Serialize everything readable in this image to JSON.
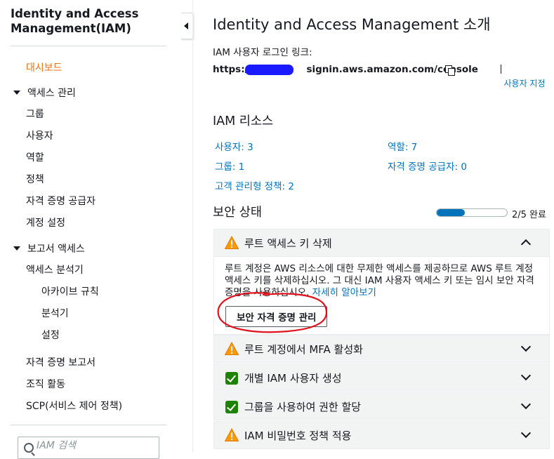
{
  "sidebar": {
    "title": "Identity and Access Management(IAM)",
    "dashboard": "대시보드",
    "access_group": "액세스 관리",
    "access_items": [
      "그룹",
      "사용자",
      "역할",
      "정책",
      "자격 증명 공급자",
      "계정 설정"
    ],
    "report_group": "보고서 액세스",
    "report_items": [
      "액세스 분석기"
    ],
    "analyzer_sub": [
      "아카이브 규칙",
      "분석기",
      "설정"
    ],
    "more_items": [
      "자격 증명 보고서",
      "조직 활동",
      "SCP(서비스 제어 정책)"
    ],
    "search_placeholder": "IAM 검색"
  },
  "main": {
    "title": "Identity and Access Management 소개",
    "signin_label": "IAM 사용자 로그인 링크:",
    "signin_url_prefix": "https://",
    "signin_url_suffix": "signin.aws.amazon.com/console",
    "customize_link": "사용자 지정",
    "resources_title": "IAM 리소스",
    "resources": {
      "users": "사용자: 3",
      "roles": "역할: 7",
      "groups": "그룹: 1",
      "idp": "자격 증명 공급자: 0",
      "policies": "고객 관리형 정책: 2"
    },
    "security_title": "보안 상태",
    "security_progress": 0.4,
    "security_progress_text": "2/5 완료",
    "accordion": [
      {
        "title": "루트 액세스 키 삭제",
        "status": "warning",
        "expanded": true,
        "body": "루트 계정은 AWS 리소스에 대한 무제한 액세스를 제공하므로 AWS 루트 계정 액세스 키를 삭제하십시오. 그 대신 IAM 사용자 액세스 키 또는 임시 보안 자격 증명을 사용하십시오.",
        "learn_more": "자세히 알아보기",
        "button": "보안 자격 증명 관리"
      },
      {
        "title": "루트 계정에서 MFA 활성화",
        "status": "warning",
        "expanded": false
      },
      {
        "title": "개별 IAM 사용자 생성",
        "status": "complete",
        "expanded": false
      },
      {
        "title": "그룹을 사용하여 권한 할당",
        "status": "complete",
        "expanded": false
      },
      {
        "title": "IAM 비밀번호 정책 적용",
        "status": "warning",
        "expanded": false
      }
    ]
  },
  "colors": {
    "accent_orange": "#ec7211",
    "link_blue": "#0073bb",
    "warning_orange": "#ff9900",
    "success_green": "#1d8102",
    "annotation_red": "#e0141e",
    "redaction_blue": "#1a1aff"
  }
}
